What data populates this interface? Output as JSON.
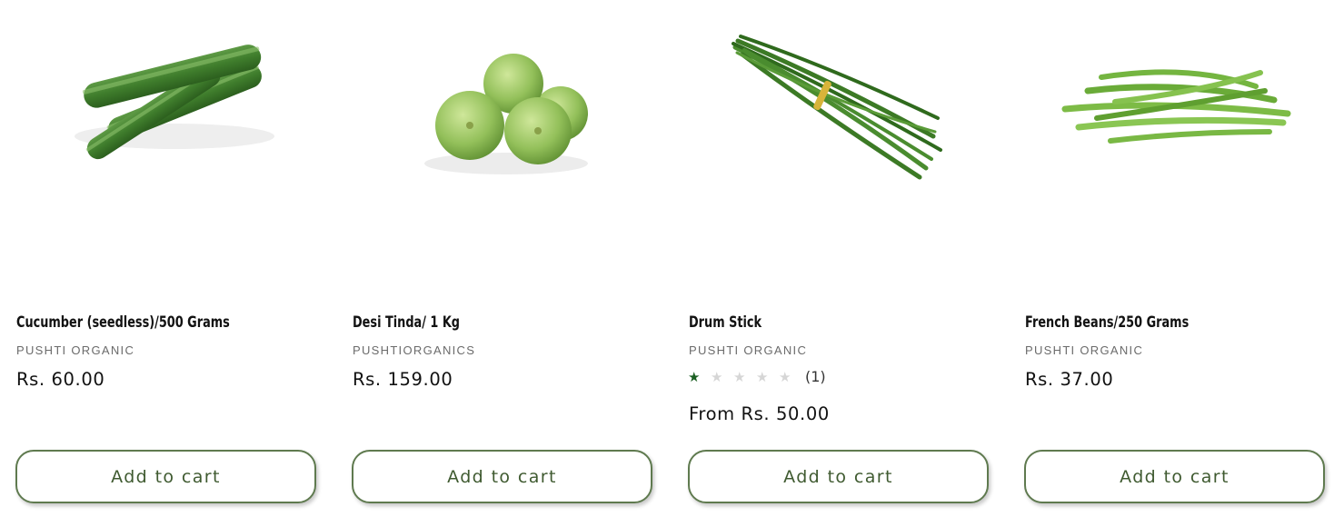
{
  "products": [
    {
      "image_alt": "cucumber",
      "title": "Cucumber (seedless)/500 Grams",
      "vendor": "PUSHTI ORGANIC",
      "price": "Rs. 60.00",
      "cart_label": "Add to cart"
    },
    {
      "image_alt": "tinda",
      "title": "Desi Tinda/ 1 Kg",
      "vendor": "PUSHTIORGANICS",
      "price": "Rs. 159.00",
      "cart_label": "Add to cart"
    },
    {
      "image_alt": "drumstick",
      "title": "Drum Stick",
      "vendor": "PUSHTI ORGANIC",
      "rating": {
        "value": 1,
        "max": 5,
        "count_label": "(1)"
      },
      "price": "From Rs. 50.00",
      "cart_label": "Add to cart"
    },
    {
      "image_alt": "french-beans",
      "title": "French Beans/250 Grams",
      "vendor": "PUSHTI ORGANIC",
      "price": "Rs. 37.00",
      "cart_label": "Add to cart"
    }
  ],
  "colors": {
    "accent": "#5f7a4f",
    "button_text": "#3f5a30",
    "star_filled": "#1a5f22",
    "star_empty": "#d6d6d6",
    "vendor_text": "#6b6b6b"
  }
}
